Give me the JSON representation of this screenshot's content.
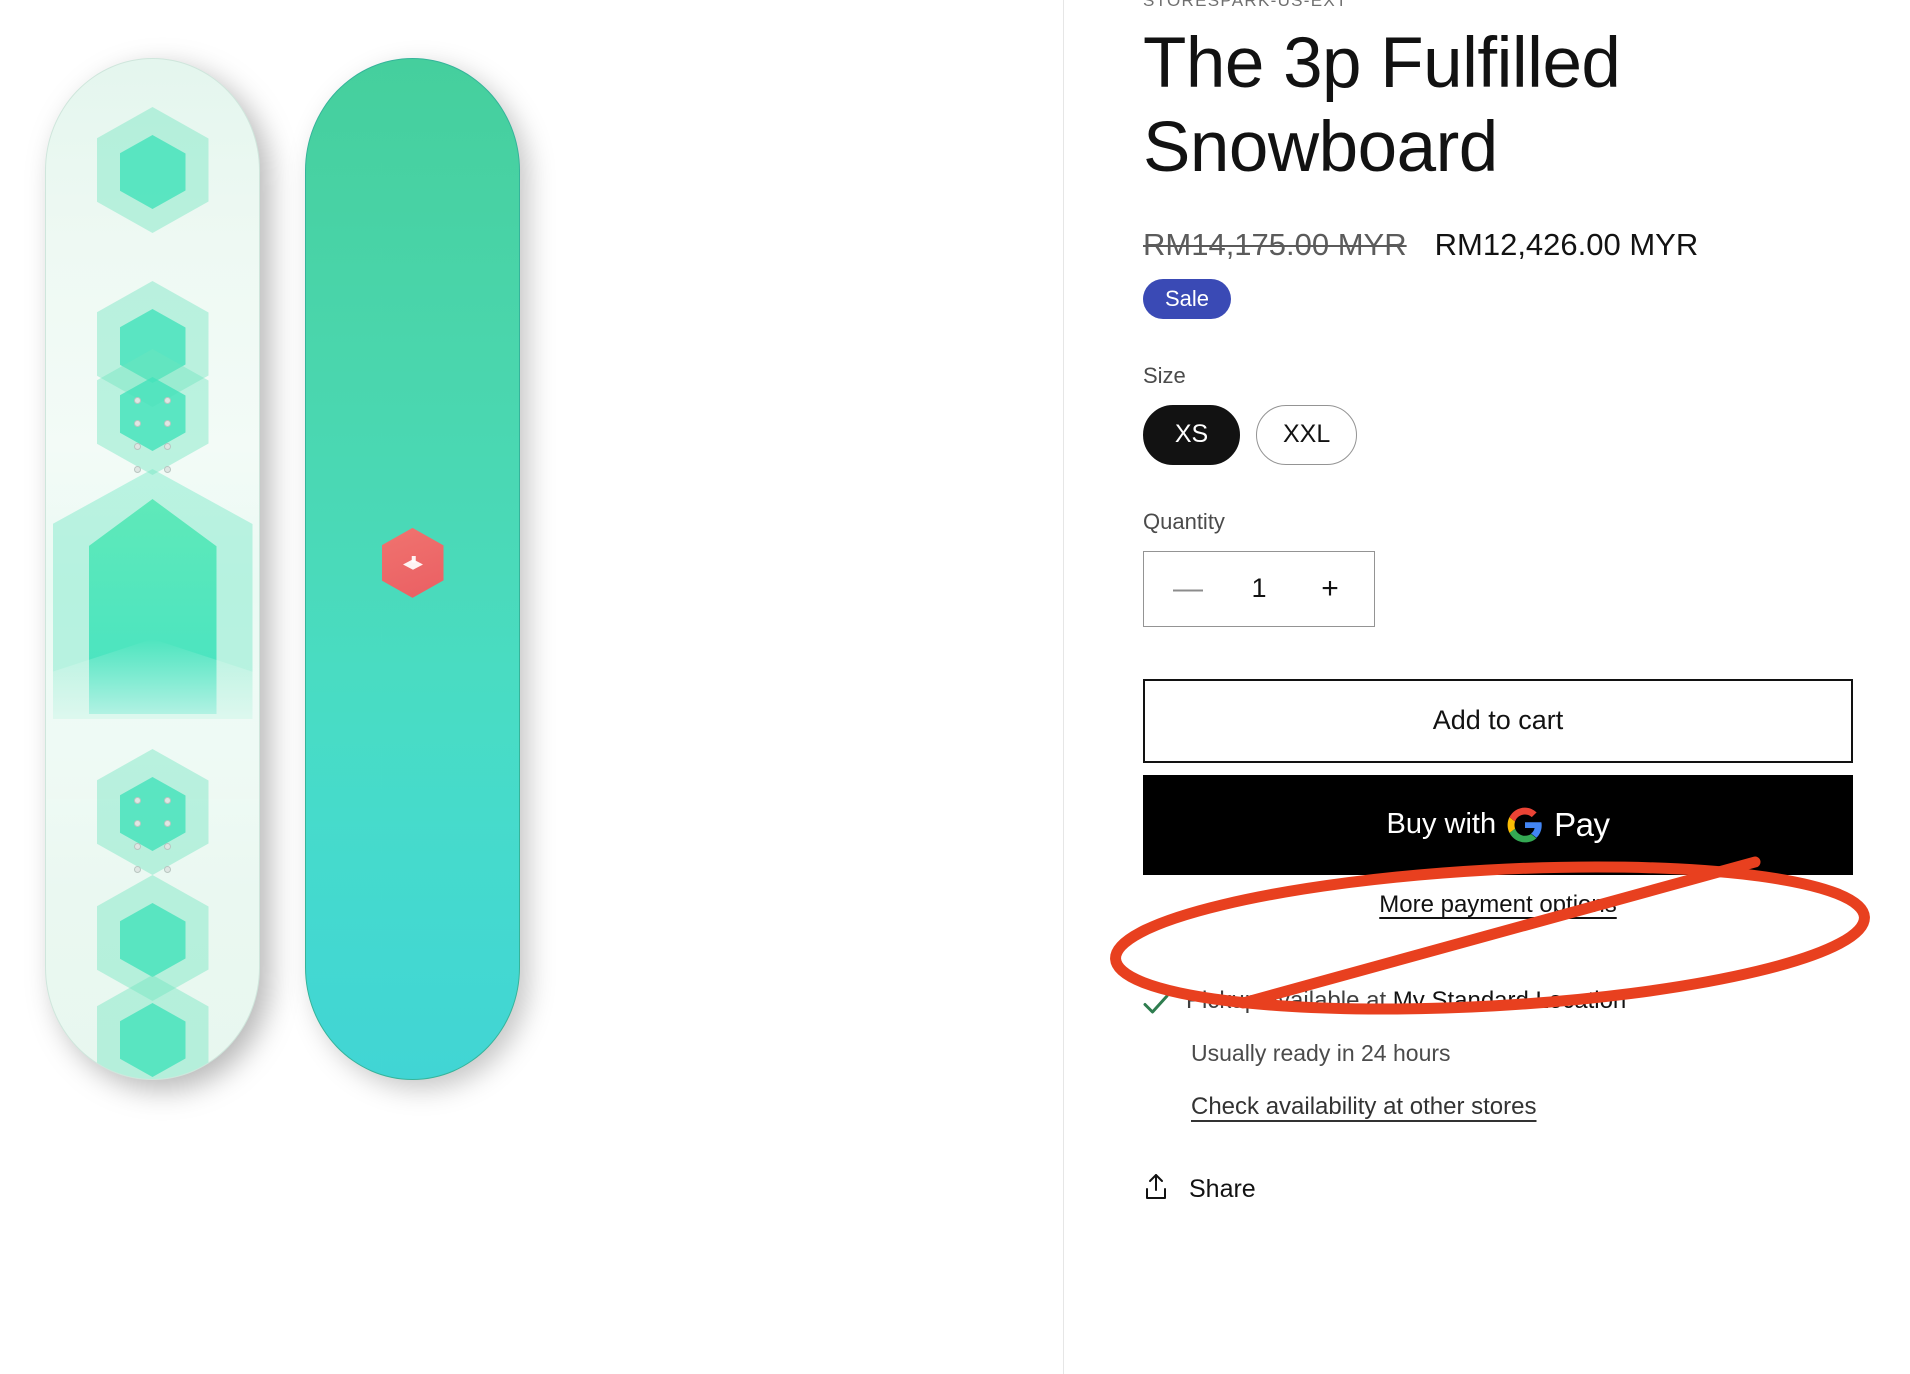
{
  "gallery": {
    "board_left_alt": "snowboard-pale-mint-hexagon-graphic",
    "board_right_alt": "snowboard-teal-gradient-with-logo"
  },
  "product": {
    "vendor": "STORESPARK-US-EXT",
    "title": "The 3p Fulfilled Snowboard",
    "price_compare": "RM14,175.00 MYR",
    "price_current": "RM12,426.00 MYR",
    "sale_badge": "Sale"
  },
  "size": {
    "label": "Size",
    "options": [
      {
        "label": "XS",
        "selected": true
      },
      {
        "label": "XXL",
        "selected": false
      }
    ]
  },
  "quantity": {
    "label": "Quantity",
    "value": "1",
    "decrease": "—",
    "increase": "+"
  },
  "actions": {
    "add_to_cart": "Add to cart",
    "gpay_prefix": "Buy with",
    "gpay_suffix": "Pay",
    "more_payment_options": "More payment options"
  },
  "pickup": {
    "availability_prefix": "Pickup available at ",
    "location": "My Standard Location",
    "ready_time": "Usually ready in 24 hours",
    "other_stores_link": "Check availability at other stores"
  },
  "share": {
    "label": "Share"
  },
  "colors": {
    "sale_badge_bg": "#3a4ab5",
    "check_green": "#2e7d4f",
    "annotation_red": "#e8401f",
    "gpay_bg": "#000000",
    "board_left": "#eaf8f1",
    "board_right": "#45cf9d",
    "logo_hex": "#ea5f63"
  }
}
